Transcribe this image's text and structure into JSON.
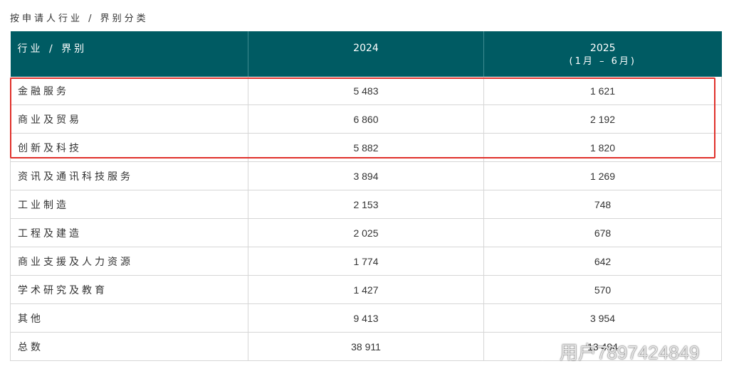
{
  "caption": "按申请人行业 / 界别分类",
  "table": {
    "headers": {
      "category": "行业 / 界别",
      "year1": "2024",
      "year2": "2025",
      "year2_sub": "(1月 – 6月)"
    },
    "rows": [
      {
        "category": "金融服务",
        "v2024": "5 483",
        "v2025": "1 621"
      },
      {
        "category": "商业及贸易",
        "v2024": "6 860",
        "v2025": "2 192"
      },
      {
        "category": "创新及科技",
        "v2024": "5 882",
        "v2025": "1 820"
      },
      {
        "category": "资讯及通讯科技服务",
        "v2024": "3 894",
        "v2025": "1 269"
      },
      {
        "category": "工业制造",
        "v2024": "2 153",
        "v2025": "748"
      },
      {
        "category": "工程及建造",
        "v2024": "2 025",
        "v2025": "678"
      },
      {
        "category": "商业支援及人力资源",
        "v2024": "1 774",
        "v2025": "642"
      },
      {
        "category": "学术研究及教育",
        "v2024": "1 427",
        "v2025": "570"
      },
      {
        "category": "其他",
        "v2024": "9 413",
        "v2025": "3 954"
      },
      {
        "category": "总数",
        "v2024": "38 911",
        "v2025": "13 494"
      }
    ]
  },
  "highlight_color": "#e0302a",
  "header_color": "#005b63",
  "watermark": {
    "icon": "weibo-logo-icon",
    "text": "用户7897424849"
  }
}
